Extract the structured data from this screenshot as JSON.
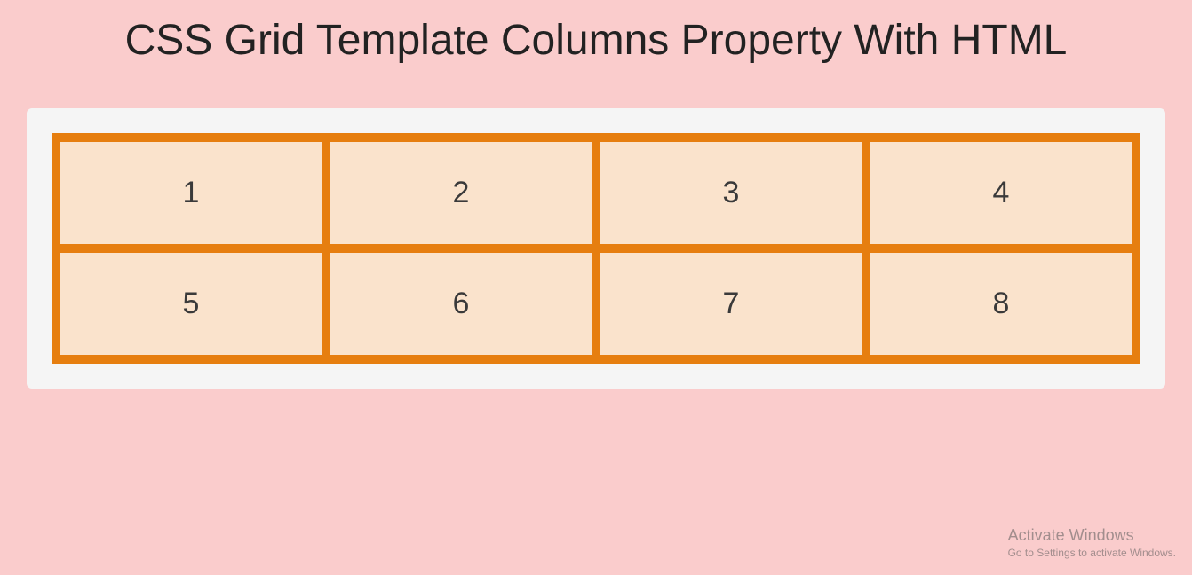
{
  "heading": "CSS Grid Template Columns Property With HTML",
  "grid": {
    "items": [
      "1",
      "2",
      "3",
      "4",
      "5",
      "6",
      "7",
      "8"
    ]
  },
  "watermark": {
    "title": "Activate Windows",
    "subtitle": "Go to Settings to activate Windows."
  }
}
